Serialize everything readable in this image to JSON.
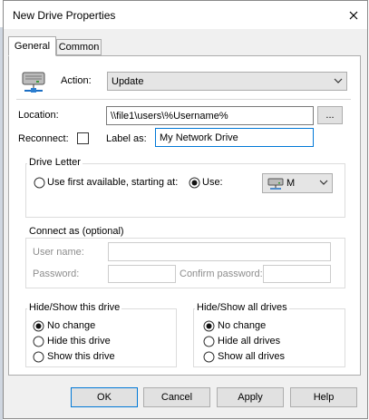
{
  "window": {
    "title": "New Drive Properties"
  },
  "tabs": [
    {
      "label": "General",
      "active": true
    },
    {
      "label": "Common",
      "active": false
    }
  ],
  "general": {
    "action_label": "Action:",
    "action_value": "Update",
    "location_label": "Location:",
    "location_value": "\\\\file1\\users\\%Username%",
    "browse_label": "...",
    "reconnect_label": "Reconnect:",
    "reconnect_checked": false,
    "label_as_label": "Label as:",
    "label_as_value": "My Network Drive"
  },
  "drive_letter": {
    "group_title": "Drive Letter",
    "use_first_label": "Use first available, starting at:",
    "use_label": "Use:",
    "selected_option": "use",
    "drive_value": "M"
  },
  "connect_as": {
    "group_title": "Connect as (optional)",
    "user_name_label": "User name:",
    "password_label": "Password:",
    "confirm_password_label": "Confirm password:"
  },
  "hide_show_drive": {
    "group_title": "Hide/Show this drive",
    "options": [
      "No change",
      "Hide this drive",
      "Show this drive"
    ],
    "selected_index": 0
  },
  "hide_show_all": {
    "group_title": "Hide/Show all drives",
    "options": [
      "No change",
      "Hide all drives",
      "Show all drives"
    ],
    "selected_index": 0
  },
  "buttons": {
    "ok": "OK",
    "cancel": "Cancel",
    "apply": "Apply",
    "help": "Help"
  },
  "colors": {
    "focus_border": "#0078d7",
    "dialog_bg": "#f0f0f0",
    "field_bg": "#e5e5e5"
  },
  "icons": {
    "action": "network-drive-icon",
    "drive_select": "drive-icon"
  }
}
